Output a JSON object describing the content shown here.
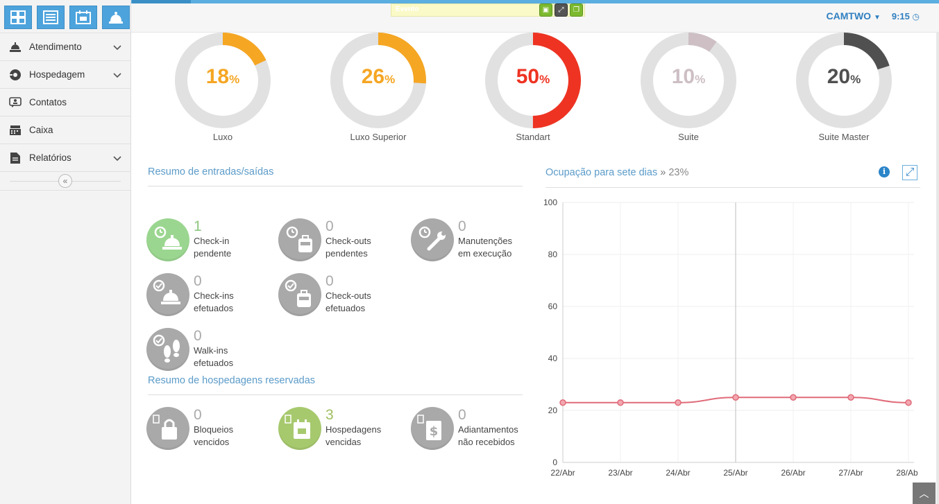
{
  "sidebar": {
    "quick_buttons": [
      {
        "name": "dashboard-grid-icon"
      },
      {
        "name": "list-icon"
      },
      {
        "name": "calendar-icon"
      },
      {
        "name": "bell-icon"
      }
    ],
    "items": [
      {
        "label": "Atendimento",
        "icon": "desk-bell-icon",
        "has_submenu": true
      },
      {
        "label": "Hospedagem",
        "icon": "key-icon",
        "has_submenu": true
      },
      {
        "label": "Contatos",
        "icon": "contacts-icon",
        "has_submenu": false
      },
      {
        "label": "Caixa",
        "icon": "cash-register-icon",
        "has_submenu": false
      },
      {
        "label": "Relatórios",
        "icon": "document-icon",
        "has_submenu": true
      }
    ],
    "collapse_glyph": "«"
  },
  "header": {
    "event_title": "Evento",
    "user": "CAMTWO",
    "time": "9:15"
  },
  "donuts": [
    {
      "label": "Luxo",
      "value": 18,
      "color": "#f5a623"
    },
    {
      "label": "Luxo Superior",
      "value": 26,
      "color": "#f5a623"
    },
    {
      "label": "Standart",
      "value": 50,
      "color": "#ee3322"
    },
    {
      "label": "Suite",
      "value": 10,
      "color": "#cdbfc4"
    },
    {
      "label": "Suite Master",
      "value": 20,
      "color": "#505050"
    }
  ],
  "resumo_entradas": {
    "title": "Resumo de entradas/saídas",
    "items": [
      {
        "num": "1",
        "line1": "Check-in",
        "line2": "pendente",
        "style": "green"
      },
      {
        "num": "0",
        "line1": "Check-outs",
        "line2": "pendentes",
        "style": "gray"
      },
      {
        "num": "0",
        "line1": "Manutenções",
        "line2": "em execução",
        "style": "gray"
      },
      {
        "num": "0",
        "line1": "Check-ins",
        "line2": "efetuados",
        "style": "gray"
      },
      {
        "num": "0",
        "line1": "Check-outs",
        "line2": "efetuados",
        "style": "gray"
      },
      {
        "num": "0",
        "line1": "Walk-ins",
        "line2": "efetuados",
        "style": "gray"
      }
    ]
  },
  "resumo_hospedagens": {
    "title": "Resumo de hospedagens reservadas",
    "items": [
      {
        "num": "0",
        "line1": "Bloqueios",
        "line2": "vencidos",
        "style": "gray"
      },
      {
        "num": "3",
        "line1": "Hospedagens",
        "line2": "vencidas",
        "style": "olive"
      },
      {
        "num": "0",
        "line1": "Adiantamentos",
        "line2": "não recebidos",
        "style": "gray"
      }
    ]
  },
  "chart_panel": {
    "title": "Ocupação para sete dias",
    "separator": "»",
    "value": "23%"
  },
  "chart_data": {
    "type": "line",
    "categories": [
      "22/Abr",
      "23/Abr",
      "24/Abr",
      "25/Abr",
      "26/Abr",
      "27/Abr",
      "28/Abr"
    ],
    "values": [
      23,
      23,
      23,
      25,
      25,
      25,
      23
    ],
    "ylim": [
      0,
      100
    ],
    "yticks": [
      "0",
      "20",
      "40",
      "60",
      "80",
      "100"
    ],
    "color": "#e06a78",
    "highlight_category": "25/Abr",
    "grid": true
  }
}
